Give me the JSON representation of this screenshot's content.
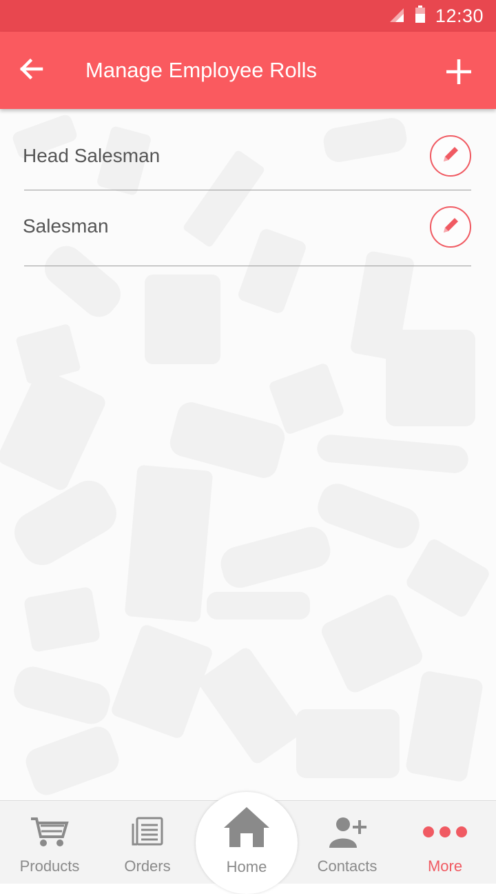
{
  "status_bar": {
    "time": "12:30",
    "signal_icon": "signal-icon",
    "battery_icon": "battery-icon"
  },
  "header": {
    "title": "Manage Employee Rolls",
    "back_icon": "arrow-left-icon",
    "add_icon": "plus-icon"
  },
  "rolls": [
    {
      "name": "Head Salesman",
      "edit_icon": "pencil-icon"
    },
    {
      "name": "Salesman",
      "edit_icon": "pencil-icon"
    }
  ],
  "bottom_nav": {
    "active": "More",
    "items": [
      {
        "label": "Products",
        "icon": "cart-icon"
      },
      {
        "label": "Orders",
        "icon": "list-icon"
      },
      {
        "label": "Home",
        "icon": "home-icon"
      },
      {
        "label": "Contacts",
        "icon": "add-contact-icon"
      },
      {
        "label": "More",
        "icon": "more-icon"
      }
    ]
  },
  "colors": {
    "status_bar": "#e8474f",
    "app_bar": "#fa5a5f",
    "accent": "#f05a62",
    "nav_inactive": "#8a8a8a"
  }
}
